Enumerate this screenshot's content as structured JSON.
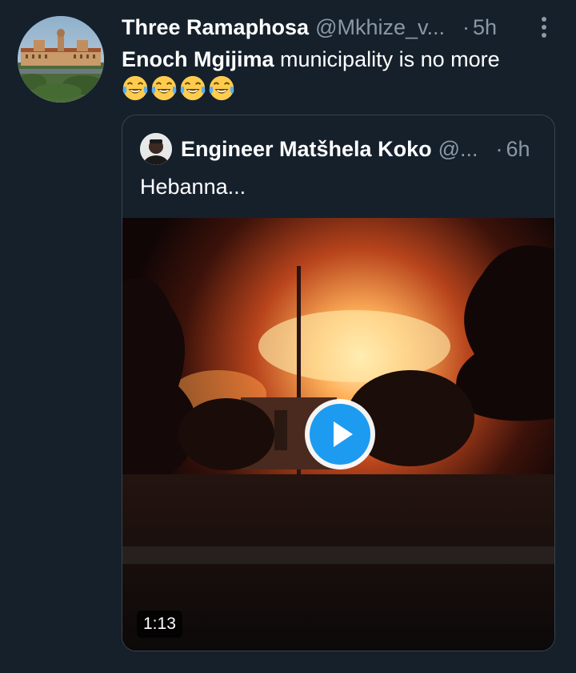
{
  "tweet": {
    "author_name": "Three Ramaphosa",
    "handle": "@Mkhize_v...",
    "separator": "·",
    "time": "5h",
    "text_mention": "Enoch Mgijima",
    "text_rest": " municipality is no more",
    "emoji": [
      "face-with-tears-of-joy",
      "face-with-tears-of-joy",
      "face-with-tears-of-joy",
      "face-with-tears-of-joy"
    ],
    "avatar_icon": "union-buildings-photo",
    "more_icon": "vertical-ellipsis-icon"
  },
  "quoted_tweet": {
    "author_name": "Engineer Matšhela Koko",
    "handle": "@...",
    "separator": "·",
    "time": "6h",
    "text": "Hebanna...",
    "avatar_icon": "person-photo",
    "media": {
      "type": "video",
      "duration": "1:13",
      "play_icon": "play-icon"
    }
  },
  "colors": {
    "background": "#15202b",
    "primary_text": "#ffffff",
    "secondary_text": "#8b98a5",
    "border": "#38444d",
    "accent": "#1d9bf0"
  }
}
